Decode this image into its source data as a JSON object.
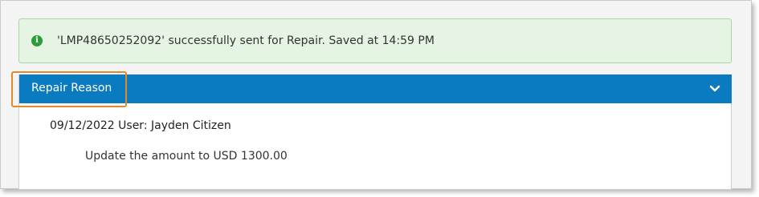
{
  "alert": {
    "icon": "info-circle-icon",
    "message": "'LMP48650252092' successfully sent for Repair. Saved at 14:59 PM",
    "color": "#2e9c3a"
  },
  "panel": {
    "title": "Repair Reason",
    "header_color": "#0a7ac1",
    "toggle_icon": "chevron-down-icon",
    "entry": {
      "date": "09/12/2022",
      "user_label": "User:",
      "user_name": "Jayden Citizen",
      "reason": "Update the amount to USD 1300.00"
    }
  },
  "highlight": {
    "color": "#e08a2a"
  }
}
